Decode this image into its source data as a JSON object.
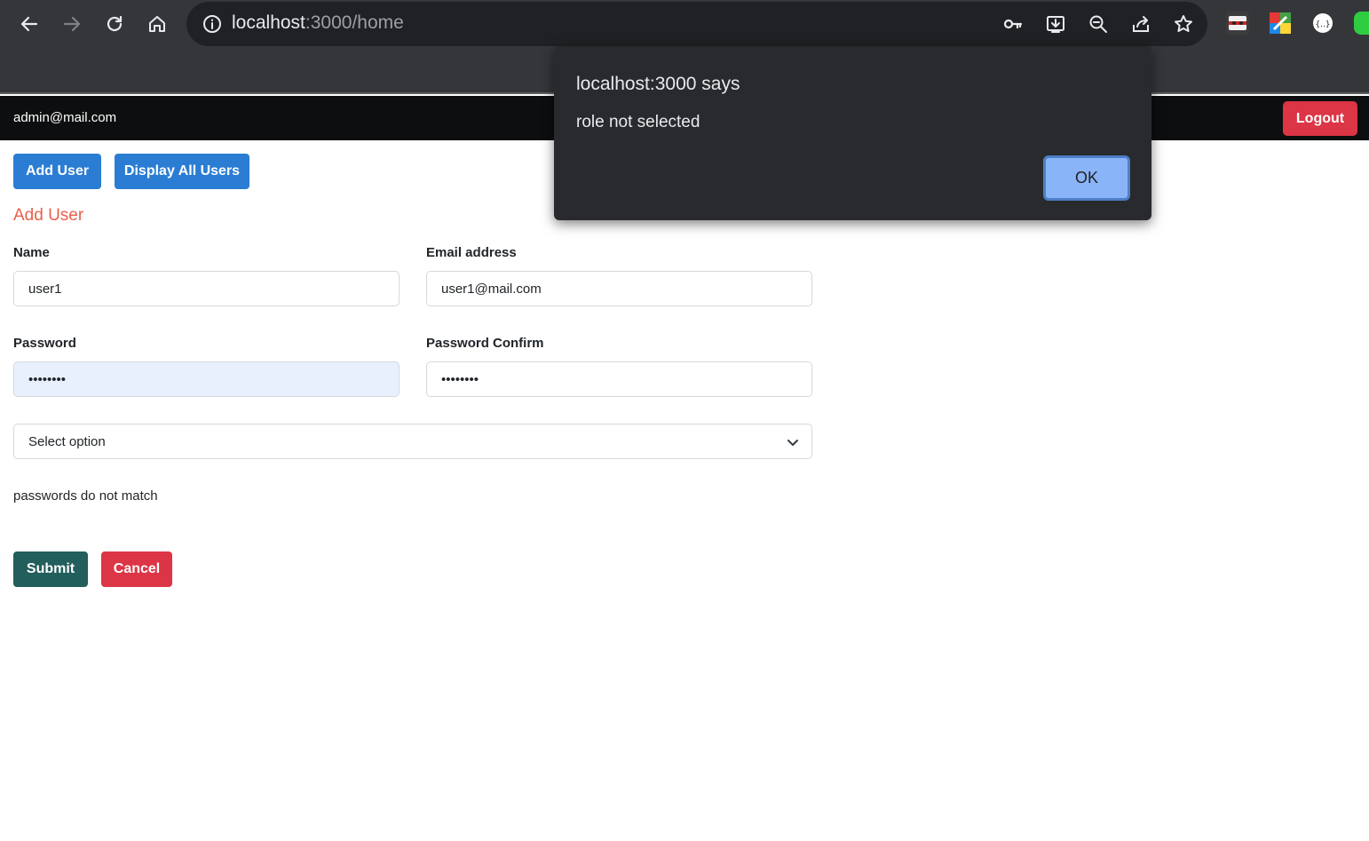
{
  "browser": {
    "url_host": "localhost",
    "url_rest": ":3000/home",
    "icons": [
      "back-icon",
      "forward-icon",
      "reload-icon",
      "home-icon",
      "info-icon",
      "key-icon",
      "install-icon",
      "zoom-out-icon",
      "share-icon",
      "star-icon"
    ]
  },
  "navbar": {
    "email": "admin@mail.com",
    "logout_label": "Logout"
  },
  "actions": {
    "add_user_label": "Add User",
    "display_all_label": "Display All Users"
  },
  "form": {
    "title": "Add User",
    "name_label": "Name",
    "name_value": "user1",
    "email_label": "Email address",
    "email_value": "user1@mail.com",
    "password_label": "Password",
    "password_value": "••••••••",
    "confirm_label": "Password Confirm",
    "confirm_value": "••••••••",
    "role_selected": "Select option",
    "error_message": "passwords do not match",
    "submit_label": "Submit",
    "cancel_label": "Cancel"
  },
  "dialog": {
    "title": "localhost:3000 says",
    "message": "role not selected",
    "ok_label": "OK"
  },
  "colors": {
    "accent_blue": "#2b7dd3",
    "danger_red": "#dc3545",
    "submit_teal": "#225e5b",
    "title_orange": "#e8604c"
  }
}
